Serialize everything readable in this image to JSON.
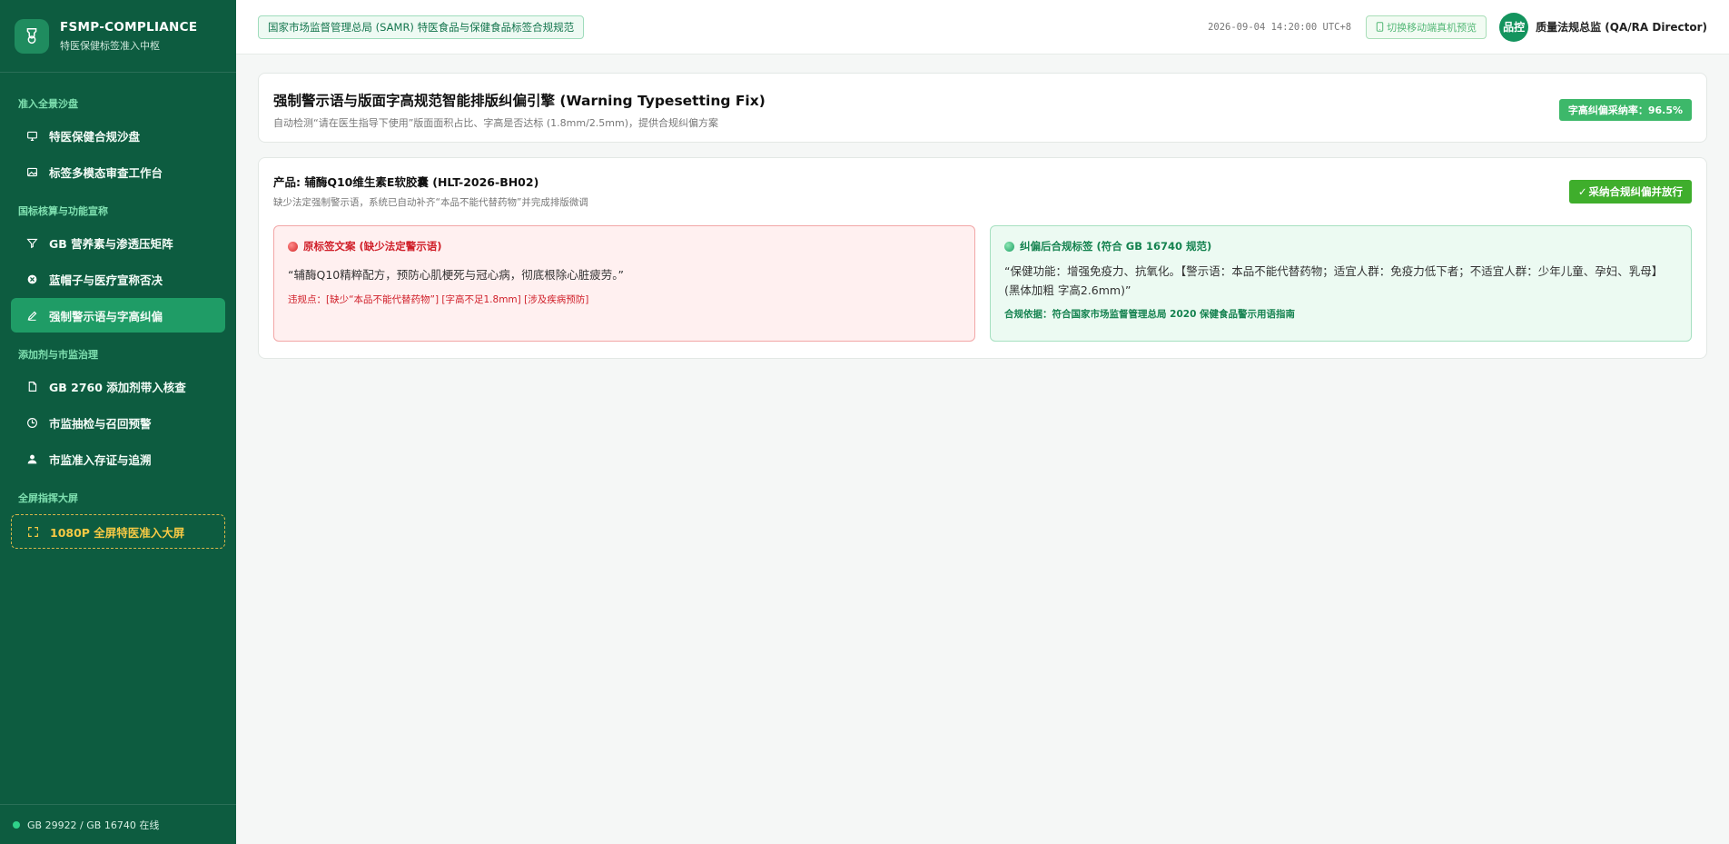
{
  "brand": {
    "title": "FSMP-COMPLIANCE",
    "subtitle": "特医保健标签准入中枢"
  },
  "sidebar": {
    "sections": [
      {
        "label": "准入全景沙盘"
      },
      {
        "label": "国标核算与功能宣称"
      },
      {
        "label": "添加剂与市监治理"
      },
      {
        "label": "全屏指挥大屏"
      }
    ],
    "items": [
      {
        "label": "特医保健合规沙盘",
        "icon": "monitor-icon"
      },
      {
        "label": "标签多模态审查工作台",
        "icon": "image-icon"
      },
      {
        "label": "GB 营养素与渗透压矩阵",
        "icon": "filter-icon"
      },
      {
        "label": "蓝帽子与医疗宣称否决",
        "icon": "block-icon"
      },
      {
        "label": "强制警示语与字高纠偏",
        "icon": "edit-icon"
      },
      {
        "label": "GB 2760 添加剂带入核查",
        "icon": "file-icon"
      },
      {
        "label": "市监抽检与召回预警",
        "icon": "clock-icon"
      },
      {
        "label": "市监准入存证与追溯",
        "icon": "user-icon"
      },
      {
        "label": "1080P 全屏特医准入大屏",
        "icon": "fullscreen-icon"
      }
    ],
    "footer": "GB 29922 / GB 16740 在线"
  },
  "header": {
    "regulator_badge": "国家市场监督管理总局 (SAMR) 特医食品与保健食品标签合规规范",
    "timestamp": "2026-09-04 14:20:00 UTC+8",
    "mobile_preview": "切换移动端真机预览",
    "avatar_text": "品控",
    "user_name": "质量法规总监 (QA/RA Director)"
  },
  "title_card": {
    "title": "强制警示语与版面字高规范智能排版纠偏引擎 (Warning Typesetting Fix)",
    "subtitle": "自动检测“请在医生指导下使用”版面面积占比、字高是否达标 (1.8mm/2.5mm)，提供合规纠偏方案",
    "rate_badge": "字高纠偏采纳率：96.5%"
  },
  "product": {
    "name": "产品: 辅酶Q10维生素E软胶囊 (HLT-2026-BH02)",
    "desc": "缺少法定强制警示语，系统已自动补齐“本品不能代替药物”并完成排版微调",
    "adopt_button": "采纳合规纠偏并放行",
    "original": {
      "title": "原标签文案 (缺少法定警示语)",
      "text": "“辅酶Q10精粹配方，预防心肌梗死与冠心病，彻底根除心脏疲劳。”",
      "violation": "违规点：[缺少“本品不能代替药物”] [字高不足1.8mm] [涉及疾病预防]"
    },
    "corrected": {
      "title": "纠偏后合规标签 (符合 GB 16740 规范)",
      "text": "“保健功能：增强免疫力、抗氧化。【警示语：本品不能代替药物；适宜人群：免疫力低下者；不适宜人群：少年儿童、孕妇、乳母】(黑体加粗 字高2.6mm)”",
      "basis": "合规依据：符合国家市场监督管理总局 2020 保健食品警示用语指南"
    }
  },
  "colors": {
    "sidebar_bg": "#0d5c40",
    "active": "#1f9c66",
    "accent_green": "#3db86a",
    "error_red": "#d0202a"
  }
}
